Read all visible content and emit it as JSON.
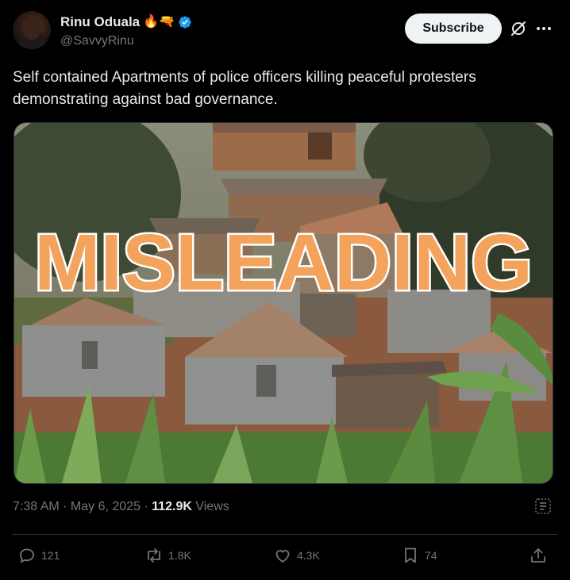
{
  "author": {
    "name": "Rinu Oduala",
    "emoji": "🔥🔫",
    "handle": "@SavvyRinu"
  },
  "header": {
    "subscribe_label": "Subscribe"
  },
  "tweet": {
    "text": "Self contained Apartments of police officers killing peaceful protesters demonstrating against bad governance.",
    "image_overlay": "MISLEADING"
  },
  "meta": {
    "time": "7:38 AM",
    "separator": " · ",
    "date": "May 6, 2025",
    "views_count": "112.9K",
    "views_label": " Views"
  },
  "actions": {
    "replies": "121",
    "reposts": "1.8K",
    "likes": "4.3K",
    "bookmarks": "74"
  },
  "colors": {
    "verified": "#1d9bf0",
    "overlay_fill": "#f4a35c",
    "overlay_stroke": "#ffffff"
  }
}
